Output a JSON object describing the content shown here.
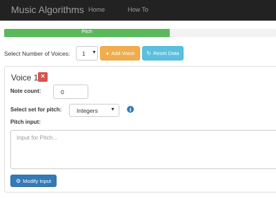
{
  "navbar": {
    "brand": "Music Algorithms",
    "links": [
      "Home",
      "How To"
    ]
  },
  "progress": {
    "label": "Pitch",
    "fraction": 0.61,
    "color": "#5cb85c"
  },
  "voices": {
    "label": "Select Number of Voices:",
    "selected": "1",
    "add_button": "Add Voice",
    "reset_button": "Reset Data"
  },
  "voice_panel": {
    "title": "Voice 1",
    "remove_icon": "x-icon",
    "note_count_label": "Note count:",
    "note_count_value": "0",
    "set_label": "Select set for pitch:",
    "set_selected": "Integers",
    "info_icon": "info-icon",
    "pitch_label": "Pitch input:",
    "pitch_placeholder": "Input for  Pitch...",
    "modify_button": "Modify Input"
  },
  "colors": {
    "navbar": "#222222",
    "warning": "#f0ad4e",
    "info": "#5bc0de",
    "primary": "#337ab7",
    "danger": "#d9534f"
  }
}
